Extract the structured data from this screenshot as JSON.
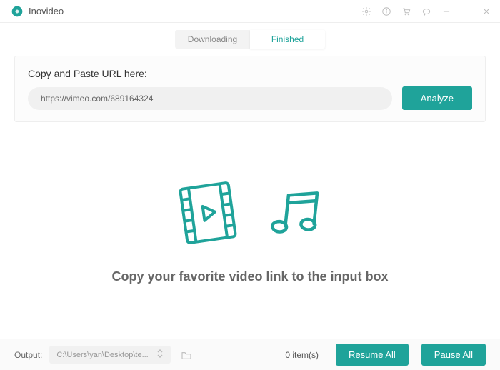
{
  "app": {
    "title": "Inovideo"
  },
  "tabs": {
    "downloading": "Downloading",
    "finished": "Finished"
  },
  "url_section": {
    "label": "Copy and Paste URL here:",
    "value": "https://vimeo.com/689164324",
    "analyze": "Analyze"
  },
  "empty": {
    "message": "Copy your favorite video link to the input box"
  },
  "footer": {
    "output_label": "Output:",
    "output_path": "C:\\Users\\yan\\Desktop\\te...",
    "items_text": "0 item(s)",
    "resume": "Resume All",
    "pause": "Pause All"
  },
  "colors": {
    "accent": "#1fa39a"
  }
}
